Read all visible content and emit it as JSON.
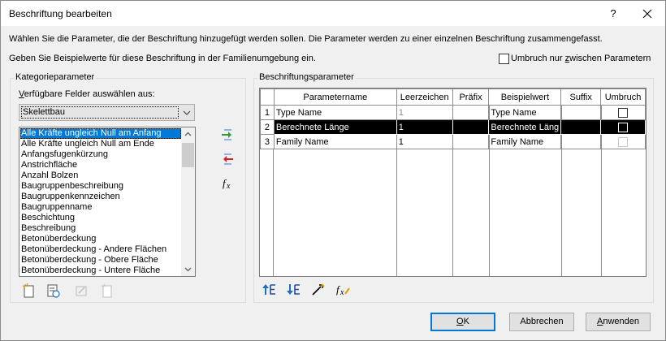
{
  "window": {
    "title": "Beschriftung bearbeiten",
    "help": "?"
  },
  "instructions": {
    "line1": "Wählen Sie die Parameter, die der Beschriftung hinzugefügt werden sollen. Die Parameter werden zu einer einzelnen Beschriftung zusammengefasst.",
    "line2": "Geben Sie Beispielwerte für diese Beschriftung in der Familienumgebung ein."
  },
  "wrap_option": {
    "label_pre": "Umbruch nur ",
    "label_accel": "z",
    "label_post": "wischen Parametern",
    "checked": false
  },
  "category_group": {
    "title": "Kategorieparameter",
    "fields_label_accel": "V",
    "fields_label_rest": "erfügbare Felder auswählen aus:",
    "selected_category": "Skelettbau",
    "items": [
      "Alle Kräfte ungleich Null am Anfang",
      "Alle Kräfte ungleich Null am Ende",
      "Anfangsfugenkürzung",
      "Anstrichfläche",
      "Anzahl Bolzen",
      "Baugruppenbeschreibung",
      "Baugruppenkennzeichen",
      "Baugruppenname",
      "Beschichtung",
      "Beschreibung",
      "Betonüberdeckung",
      "Betonüberdeckung - Andere Flächen",
      "Betonüberdeckung - Obere Fläche",
      "Betonüberdeckung - Untere Fläche"
    ],
    "selected_index": 0
  },
  "label_group": {
    "title": "Beschriftungsparameter",
    "columns": [
      "Parametername",
      "Leerzeichen",
      "Präfix",
      "Beispielwert",
      "Suffix",
      "Umbruch"
    ],
    "rows": [
      {
        "num": "1",
        "name": "Type Name",
        "spaces": "1",
        "prefix": "",
        "sample": "Type Name",
        "suffix": "",
        "wrap": false
      },
      {
        "num": "2",
        "name": "Berechnete Länge",
        "spaces": "1",
        "prefix": "",
        "sample": "Berechnete Läng",
        "suffix": "",
        "wrap": false
      },
      {
        "num": "3",
        "name": "Family Name",
        "spaces": "1",
        "prefix": "",
        "sample": "Family Name",
        "suffix": "",
        "wrap": false
      }
    ],
    "selected_row": 1
  },
  "icons": {
    "add_parameter": "add-parameter-icon",
    "remove_parameter": "remove-parameter-icon",
    "add_calculated": "fx-icon",
    "move_up": "move-up-icon",
    "move_down": "move-down-icon",
    "edit_parameter": "edit-parameter-icon",
    "edit_calculated": "edit-fx-icon"
  },
  "buttons": {
    "ok_accel": "O",
    "ok_rest": "K",
    "cancel_label": "Abbrechen",
    "apply_accel": "A",
    "apply_rest": "nwenden"
  },
  "colors": {
    "selection": "#0078d7",
    "row_highlight": "#000000",
    "green_arrow": "#2e9e3b",
    "red_arrow": "#d42020",
    "blue_arrow": "#1f6fc5"
  }
}
